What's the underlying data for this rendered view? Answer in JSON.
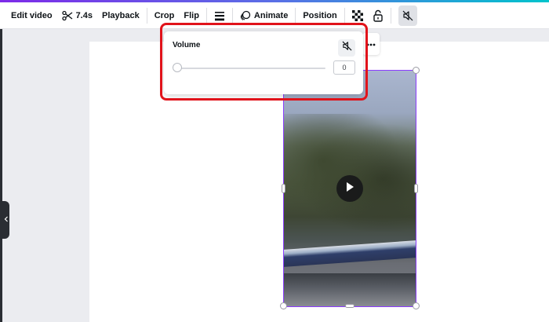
{
  "toolbar": {
    "edit_video": "Edit video",
    "trim_duration": "7.4s",
    "playback": "Playback",
    "crop": "Crop",
    "flip": "Flip",
    "animate": "Animate",
    "position": "Position",
    "icons": {
      "scissors": "scissors-icon",
      "border_style": "border-style-icon",
      "animate": "animate-icon",
      "transparency": "transparency-icon",
      "lock": "lock-icon",
      "mute": "volume-mute-icon"
    }
  },
  "volume_popup": {
    "label": "Volume",
    "value": "0",
    "level": 0,
    "mute_icon": "volume-mute-icon"
  },
  "colors": {
    "selection": "#8b3dff",
    "highlight": "#e1131b",
    "gradient_start": "#7d2ae8",
    "gradient_end": "#00c4cc"
  }
}
